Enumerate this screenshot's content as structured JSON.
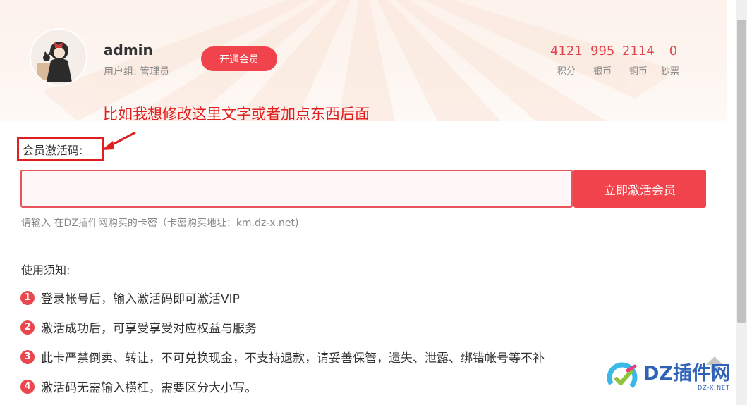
{
  "profile": {
    "username": "admin",
    "group_label": "用户组:",
    "group_value": "管理员",
    "vip_button": "开通会员"
  },
  "stats": [
    {
      "value": "4121",
      "label": "积分"
    },
    {
      "value": "995",
      "label": "银币"
    },
    {
      "value": "2114",
      "label": "铜币"
    },
    {
      "value": "0",
      "label": "钞票"
    }
  ],
  "annotation": "比如我想修改这里文字或者加点东西后面",
  "activation": {
    "label": "会员激活码:",
    "input_value": "",
    "button": "立即激活会员",
    "hint": "请输入 在DZ插件网购买的卡密（卡密购买地址：km.dz-x.net)"
  },
  "notice": {
    "title": "使用须知:",
    "items": [
      {
        "num": "1",
        "text": "登录帐号后，输入激活码即可激活VIP"
      },
      {
        "num": "2",
        "text": "激活成功后，可享受享受对应权益与服务"
      },
      {
        "num": "3",
        "text": "此卡严禁倒卖、转让，不可兑换现金，不支持退款，请妥善保管，遗失、泄露、绑错帐号等不补"
      },
      {
        "num": "4",
        "text": "激活码无需输入横杠，需要区分大小写。"
      }
    ]
  },
  "watermark": {
    "brand": "DZ插件网",
    "domain": "DZ-X.NET"
  },
  "colors": {
    "accent": "#f0434b",
    "annotation": "#e02020",
    "watermark": "#2e63b8"
  },
  "icons": {
    "back_to_top": "arrow-up-icon",
    "logo": "dz-logo-icon"
  }
}
